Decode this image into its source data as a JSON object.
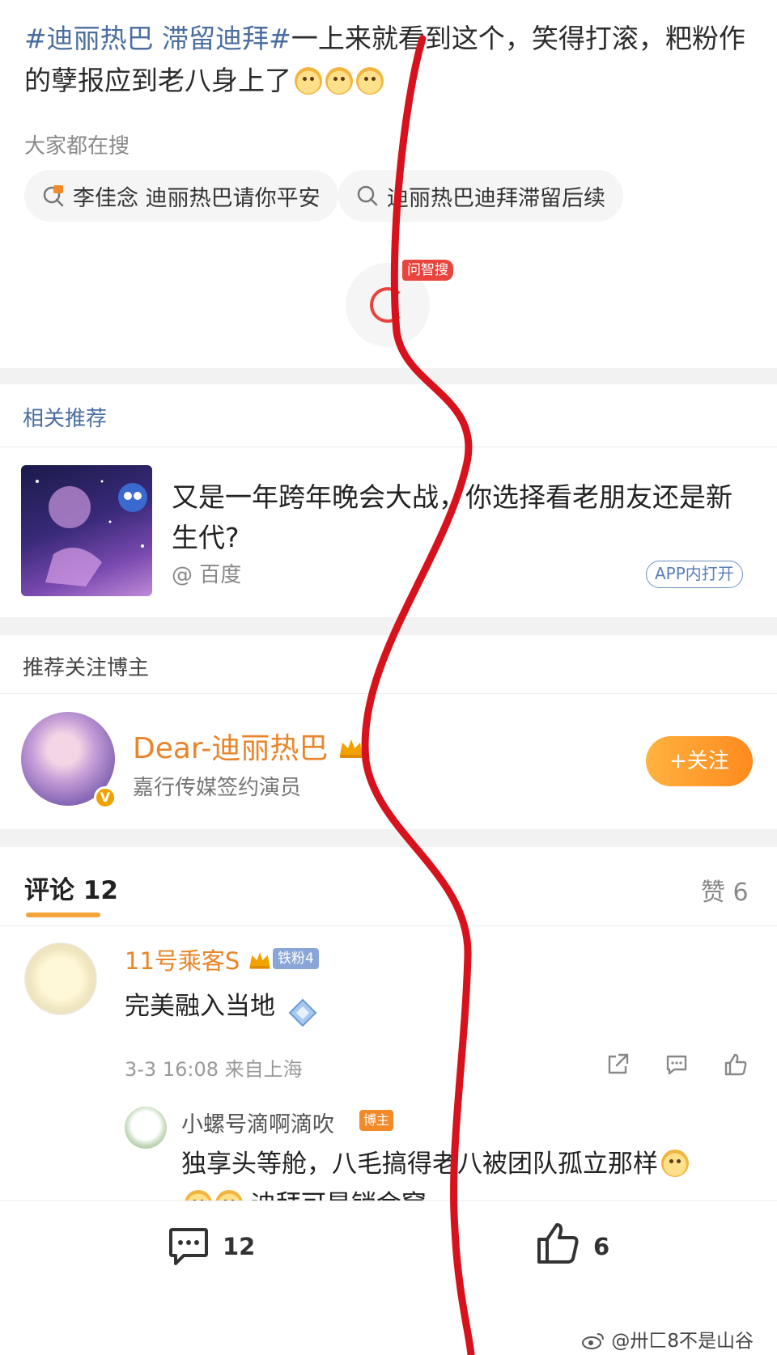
{
  "post": {
    "hashtag1": "#迪丽热巴",
    "hashtag2": "滞留迪拜#",
    "text": "一上来就看到这个，笑得打滚，粑粉作的孽报应到老八身上了"
  },
  "search": {
    "title": "大家都在搜",
    "items": [
      {
        "label": "李佳念 迪丽热巴请你平安",
        "icon": "hot-search-icon"
      },
      {
        "label": "迪丽热巴迪拜滞留后续",
        "icon": "search-icon"
      }
    ]
  },
  "zhisou": {
    "badge": "问智搜"
  },
  "recommend": {
    "section_title": "相关推荐",
    "title": "又是一年跨年晚会大战，你选择看老朋友还是新生代?",
    "source": "@ 百度",
    "app_button": "APP内打开"
  },
  "blogger": {
    "section_title": "推荐关注博主",
    "name": "Dear-迪丽热巴",
    "desc": "嘉行传媒签约演员",
    "verified": "V",
    "follow_label": "+关注"
  },
  "comments": {
    "title": "评论 12",
    "likes": "赞 6",
    "items": [
      {
        "name": "11号乘客S",
        "badge": "铁粉4",
        "text": "完美融入当地",
        "meta": "3-3 16:08 来自上海"
      }
    ],
    "reply": {
      "name": "小螺号滴啊滴吹",
      "badge": "博主",
      "text": "独享头等舱，八毛搞得老八被团队孤立那样",
      "text2": "迪拜可是销金窟"
    }
  },
  "bottom_bar": {
    "comment_count": "12",
    "like_count": "6"
  },
  "watermark": "@卅匚8不是山谷",
  "colors": {
    "accent_orange": "#f3a53a",
    "link_blue": "#4a6ea0",
    "annotation_red": "#d8121c"
  }
}
